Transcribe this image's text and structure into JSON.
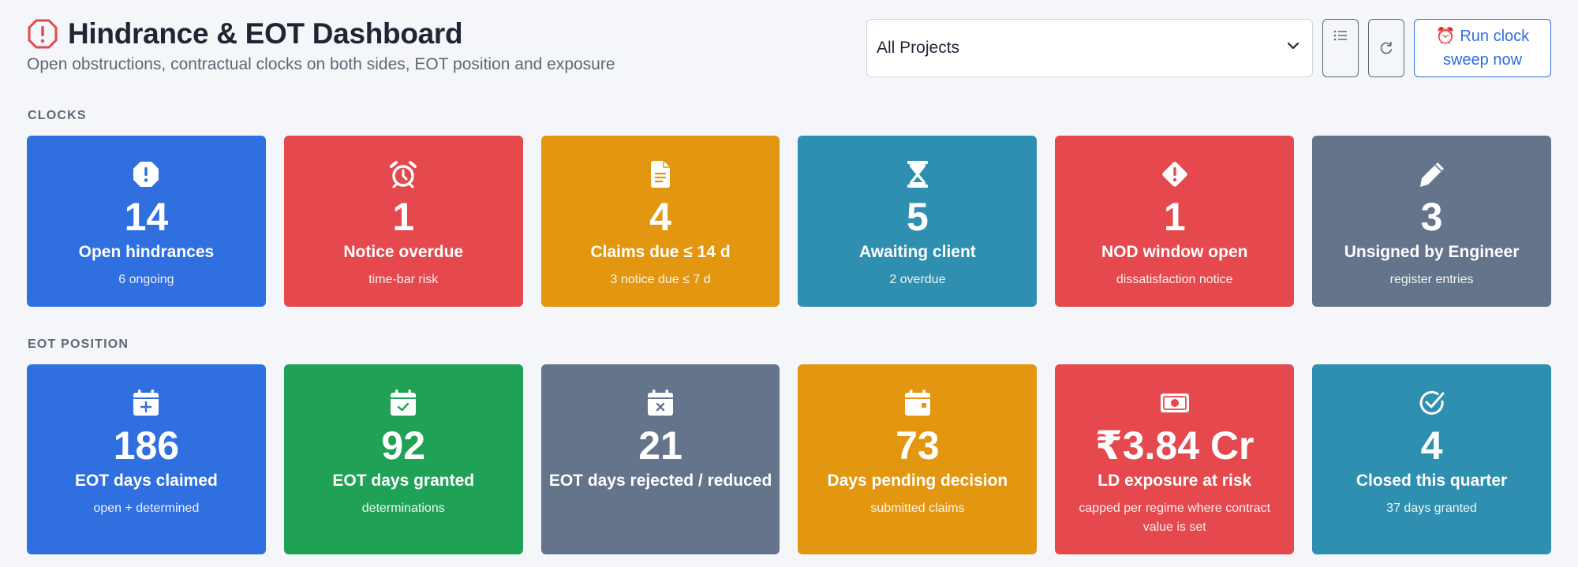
{
  "header": {
    "title": "Hindrance & EOT Dashboard",
    "subtitle": "Open obstructions, contractual clocks on both sides, EOT position and exposure",
    "title_icon": "alert-octagon-icon"
  },
  "controls": {
    "project_select": "All Projects",
    "list_icon": "list-icon",
    "refresh_icon": "refresh-icon",
    "run_button_line1": "⏰ Run clock",
    "run_button_line2": "sweep now"
  },
  "sections": {
    "clocks": "CLOCKS",
    "eot": "EOT POSITION"
  },
  "clock_cards": [
    {
      "value": "14",
      "label": "Open hindrances",
      "sub": "6 ongoing",
      "icon": "alert-octagon-icon",
      "color": "#2f6fe0"
    },
    {
      "value": "1",
      "label": "Notice overdue",
      "sub": "time-bar risk",
      "icon": "alarm-clock-icon",
      "color": "#e5484d"
    },
    {
      "value": "4",
      "label": "Claims due ≤ 14 d",
      "sub": "3 notice due ≤ 7 d",
      "icon": "document-icon",
      "color": "#e3960f"
    },
    {
      "value": "5",
      "label": "Awaiting client",
      "sub": "2 overdue",
      "icon": "hourglass-icon",
      "color": "#2e8fb0"
    },
    {
      "value": "1",
      "label": "NOD window open",
      "sub": "dissatisfaction notice",
      "icon": "alert-diamond-icon",
      "color": "#e5484d"
    },
    {
      "value": "3",
      "label": "Unsigned by Engineer",
      "sub": "register entries",
      "icon": "pen-icon",
      "color": "#64748b"
    }
  ],
  "eot_cards": [
    {
      "value": "186",
      "label": "EOT days claimed",
      "sub": "open + determined",
      "icon": "calendar-plus-icon",
      "color": "#2f6fe0"
    },
    {
      "value": "92",
      "label": "EOT days granted",
      "sub": "determinations",
      "icon": "calendar-check-icon",
      "color": "#20a256"
    },
    {
      "value": "21",
      "label": "EOT days rejected / reduced",
      "sub": "",
      "icon": "calendar-x-icon",
      "color": "#64748b"
    },
    {
      "value": "73",
      "label": "Days pending decision",
      "sub": "submitted claims",
      "icon": "calendar-icon",
      "color": "#e3960f"
    },
    {
      "value": "₹3.84 Cr",
      "label": "LD exposure at risk",
      "sub": "capped per regime where contract value is set",
      "icon": "cash-icon",
      "color": "#e5484d"
    },
    {
      "value": "4",
      "label": "Closed this quarter",
      "sub": "37 days granted",
      "icon": "check-circle-icon",
      "color": "#2e8fb0"
    }
  ]
}
